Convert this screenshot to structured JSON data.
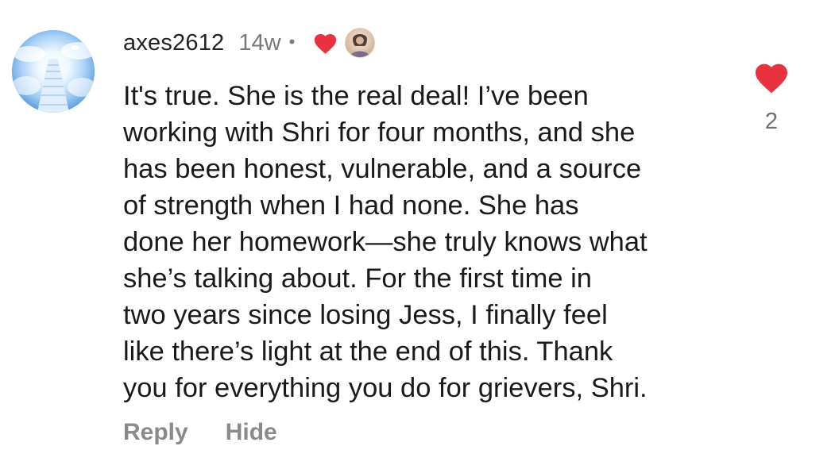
{
  "comment": {
    "username": "axes2612",
    "timestamp": "14w",
    "separator": "•",
    "liked_by_creator_icon": "heart-filled-icon",
    "colors": {
      "heart": "#e8323f",
      "muted_text": "#7a7a7a",
      "action_text": "#8a8a8a"
    },
    "body_lines": [
      "It's true. She is the real deal! I’ve been",
      "working with Shri for four months, and she",
      "has been honest, vulnerable, and a source",
      "of strength when I had none. She has",
      "done her homework—she truly knows what",
      "she’s talking about. For the first time in",
      "two years since losing Jess, I finally feel",
      "like there’s light at the end of this. Thank",
      "you for everything you do for grievers, Shri."
    ],
    "actions": {
      "reply_label": "Reply",
      "hide_label": "Hide"
    },
    "like": {
      "icon": "heart-filled-icon",
      "count": "2"
    }
  }
}
